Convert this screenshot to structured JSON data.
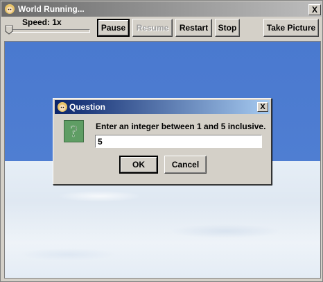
{
  "window": {
    "title": "World Running...",
    "close_label": "X"
  },
  "toolbar": {
    "speed_label": "Speed: 1x",
    "pause": "Pause",
    "resume": "Resume",
    "restart": "Restart",
    "stop": "Stop",
    "take_picture": "Take Picture"
  },
  "dialog": {
    "title": "Question",
    "close_label": "X",
    "icon_glyph": "?",
    "prompt": "Enter an integer between 1 and 5 inclusive.",
    "input_value": "5",
    "ok": "OK",
    "cancel": "Cancel"
  },
  "colors": {
    "sky": "#4a79cf",
    "snow": "#e6eef6",
    "question_icon": "#5f9d64",
    "dialog_title": "#0a246a"
  }
}
